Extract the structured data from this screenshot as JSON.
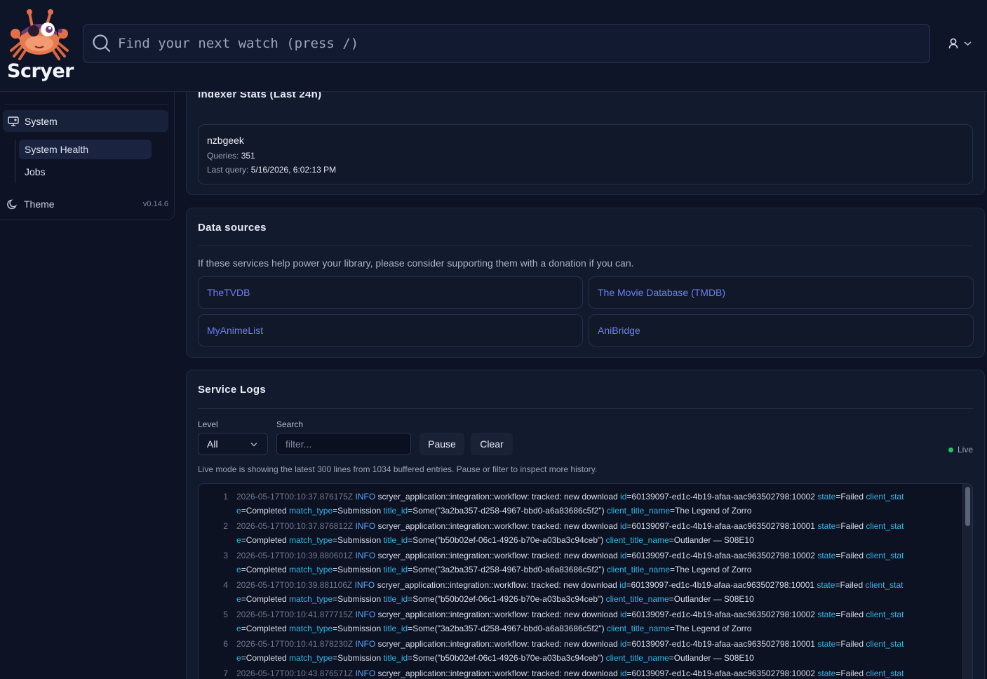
{
  "app": {
    "name": "Scryer",
    "version": "v0.14.6"
  },
  "search": {
    "placeholder": "Find your next watch (press /)"
  },
  "sidebar": {
    "section": "System",
    "items": [
      {
        "label": "System Health",
        "active": true
      },
      {
        "label": "Jobs",
        "active": false
      }
    ],
    "theme_label": "Theme"
  },
  "indexer_stats": {
    "title": "Indexer Stats (Last 24h)",
    "indexer": {
      "name": "nzbgeek",
      "queries_label": "Queries:",
      "queries": "351",
      "last_query_label": "Last query:",
      "last_query": "5/16/2026, 6:02:13 PM"
    }
  },
  "data_sources": {
    "title": "Data sources",
    "description": "If these services help power your library, please consider supporting them with a donation if you can.",
    "links": [
      "TheTVDB",
      "The Movie Database (TMDB)",
      "MyAnimeList",
      "AniBridge"
    ]
  },
  "service_logs": {
    "title": "Service Logs",
    "level_label": "Level",
    "level_value": "All",
    "search_label": "Search",
    "search_placeholder": "filter...",
    "pause_label": "Pause",
    "clear_label": "Clear",
    "live_label": "Live",
    "live_note": "Live mode is showing the latest 300 lines from 1034 buffered entries. Pause or filter to inspect more history.",
    "entries": [
      {
        "num": "1",
        "ts": "2026-05-17T00:10:37.876175Z",
        "level": "INFO",
        "source": "scryer_application::integration::workflow:",
        "message": "tracked: new download",
        "id": "60139097-ed1c-4b19-afaa-aac963502798:10002",
        "state": "Failed",
        "client_state": "Completed",
        "match_type": "Submission",
        "title_id": "Some(\"3a2ba357-d258-4967-bbd0-a6a83686c5f2\")",
        "client_title_name": "The Legend of Zorro"
      },
      {
        "num": "2",
        "ts": "2026-05-17T00:10:37.876812Z",
        "level": "INFO",
        "source": "scryer_application::integration::workflow:",
        "message": "tracked: new download",
        "id": "60139097-ed1c-4b19-afaa-aac963502798:10001",
        "state": "Failed",
        "client_state": "Completed",
        "match_type": "Submission",
        "title_id": "Some(\"b50b02ef-06c1-4926-b70e-a03ba3c94ceb\")",
        "client_title_name": "Outlander — S08E10"
      },
      {
        "num": "3",
        "ts": "2026-05-17T00:10:39.880601Z",
        "level": "INFO",
        "source": "scryer_application::integration::workflow:",
        "message": "tracked: new download",
        "id": "60139097-ed1c-4b19-afaa-aac963502798:10002",
        "state": "Failed",
        "client_state": "Completed",
        "match_type": "Submission",
        "title_id": "Some(\"3a2ba357-d258-4967-bbd0-a6a83686c5f2\")",
        "client_title_name": "The Legend of Zorro"
      },
      {
        "num": "4",
        "ts": "2026-05-17T00:10:39.881106Z",
        "level": "INFO",
        "source": "scryer_application::integration::workflow:",
        "message": "tracked: new download",
        "id": "60139097-ed1c-4b19-afaa-aac963502798:10001",
        "state": "Failed",
        "client_state": "Completed",
        "match_type": "Submission",
        "title_id": "Some(\"b50b02ef-06c1-4926-b70e-a03ba3c94ceb\")",
        "client_title_name": "Outlander — S08E10"
      },
      {
        "num": "5",
        "ts": "2026-05-17T00:10:41.877715Z",
        "level": "INFO",
        "source": "scryer_application::integration::workflow:",
        "message": "tracked: new download",
        "id": "60139097-ed1c-4b19-afaa-aac963502798:10002",
        "state": "Failed",
        "client_state": "Completed",
        "match_type": "Submission",
        "title_id": "Some(\"3a2ba357-d258-4967-bbd0-a6a83686c5f2\")",
        "client_title_name": "The Legend of Zorro"
      },
      {
        "num": "6",
        "ts": "2026-05-17T00:10:41.878230Z",
        "level": "INFO",
        "source": "scryer_application::integration::workflow:",
        "message": "tracked: new download",
        "id": "60139097-ed1c-4b19-afaa-aac963502798:10001",
        "state": "Failed",
        "client_state": "Completed",
        "match_type": "Submission",
        "title_id": "Some(\"b50b02ef-06c1-4926-b70e-a03ba3c94ceb\")",
        "client_title_name": "Outlander — S08E10"
      },
      {
        "num": "7",
        "ts": "2026-05-17T00:10:43.876571Z",
        "level": "INFO",
        "source": "scryer_application::integration::workflow:",
        "message": "tracked: new download",
        "id": "60139097-ed1c-4b19-afaa-aac963502798:10002",
        "state": "Failed",
        "client_state": "",
        "match_type": "",
        "title_id": "",
        "client_title_name": ""
      }
    ]
  },
  "colors": {
    "accent_link": "#6d7ff5",
    "log_key": "#38b6e8",
    "log_level": "#5aa8ff",
    "live_dot": "#22c55e"
  },
  "icons": [
    "crab-mascot-logo",
    "search-icon",
    "user-icon",
    "chevron-down-icon",
    "system-monitor-icon",
    "moon-icon"
  ]
}
